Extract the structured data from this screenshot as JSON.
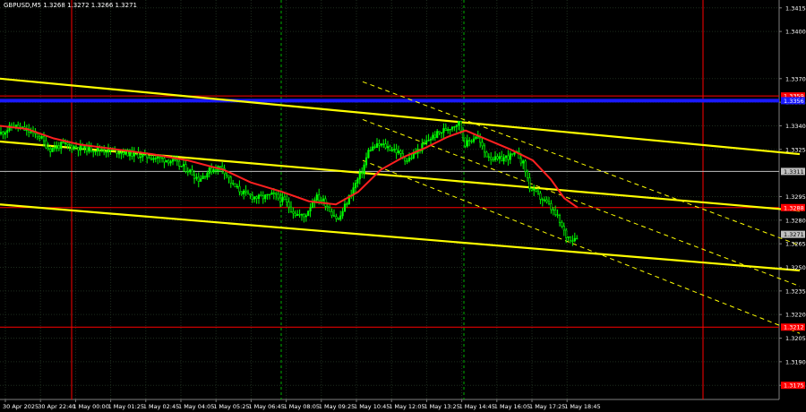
{
  "title": "GBPUSD,M5  1.3268 1.3272 1.3266 1.3271",
  "colors": {
    "background": "#000000",
    "grid": "#1e2d1e",
    "axis_text": "#ffffff",
    "candle": "#00ff00",
    "ma": "#ff2020",
    "trend": "#ffff00",
    "support_line": "#2020ff",
    "level_line": "#ff2020",
    "session_line": "#00b000",
    "label_red": "#ff0000",
    "label_blue": "#1a1aff",
    "label_grey": "#c0c0c0"
  },
  "chart_data": {
    "type": "candlestick",
    "symbol": "GBPUSD",
    "timeframe": "M5",
    "ohlc": {
      "open": 1.3268,
      "high": 1.3272,
      "low": 1.3266,
      "close": 1.3271
    },
    "y_range": [
      1.3166,
      1.342
    ],
    "y_ticks": [
      "1.3415",
      "1.3400",
      "1.3370",
      "1.3355",
      "1.3340",
      "1.3325",
      "1.3295",
      "1.3280",
      "1.3265",
      "1.3250",
      "1.3235",
      "1.3220",
      "1.3205",
      "1.3190",
      "1.3175"
    ],
    "x_ticks": [
      "30 Apr 2025",
      "30 Apr 22:40",
      "1 May 00:00",
      "1 May 01:25",
      "1 May 02:45",
      "1 May 04:05",
      "1 May 05:25",
      "1 May 06:45",
      "1 May 08:05",
      "1 May 09:25",
      "1 May 10:45",
      "1 May 12:05",
      "1 May 13:25",
      "1 May 14:45",
      "1 May 16:05",
      "1 May 17:25",
      "1 May 18:45"
    ],
    "price_labels": [
      {
        "text": "1.3359",
        "color": "#ff0000"
      },
      {
        "text": "1.3356",
        "color": "#1a1aff"
      },
      {
        "text": "1.3311",
        "color": "#c0c0c0"
      },
      {
        "text": "1.3288",
        "color": "#ff0000"
      },
      {
        "text": "1.3271",
        "color": "#c0c0c0"
      },
      {
        "text": "1.3212",
        "color": "#ff0000"
      },
      {
        "text": "1.3175",
        "color": "#ff0000"
      }
    ],
    "horizontal_levels": [
      {
        "price": 1.3356,
        "color": "#1a1aff",
        "style": "thick"
      },
      {
        "price": 1.3359,
        "color": "#ff0000",
        "style": "thin"
      },
      {
        "price": 1.3311,
        "color": "#c0c0c0",
        "style": "thin"
      },
      {
        "price": 1.3288,
        "color": "#ff0000",
        "style": "thin"
      },
      {
        "price": 1.3212,
        "color": "#ff0000",
        "style": "thin"
      }
    ],
    "trend_lines": [
      {
        "points": [
          [
            0,
            1.337
          ],
          [
            893,
            1.3322
          ]
        ],
        "style": "solid"
      },
      {
        "points": [
          [
            0,
            1.333
          ],
          [
            893,
            1.3286
          ]
        ],
        "style": "solid"
      },
      {
        "points": [
          [
            0,
            1.329
          ],
          [
            893,
            1.3248
          ]
        ],
        "style": "solid"
      },
      {
        "points": [
          [
            405,
            1.3368
          ],
          [
            893,
            1.3264
          ]
        ],
        "style": "dashed"
      },
      {
        "points": [
          [
            405,
            1.3344
          ],
          [
            893,
            1.3238
          ]
        ],
        "style": "dashed"
      },
      {
        "points": [
          [
            405,
            1.3318
          ],
          [
            893,
            1.3208
          ]
        ],
        "style": "dashed"
      }
    ],
    "vertical_lines": [
      {
        "x": 80,
        "color": "#ff0000",
        "style": "solid"
      },
      {
        "x": 785,
        "color": "#ff0000",
        "style": "solid"
      },
      {
        "x": 314,
        "color": "#00b000",
        "style": "dashed"
      },
      {
        "x": 518,
        "color": "#00b000",
        "style": "dashed"
      }
    ],
    "close_path": [
      [
        0,
        1.3335
      ],
      [
        15,
        1.334
      ],
      [
        30,
        1.3337
      ],
      [
        45,
        1.3333
      ],
      [
        55,
        1.3325
      ],
      [
        70,
        1.3328
      ],
      [
        90,
        1.3326
      ],
      [
        110,
        1.3325
      ],
      [
        130,
        1.3324
      ],
      [
        150,
        1.3322
      ],
      [
        170,
        1.332
      ],
      [
        190,
        1.3318
      ],
      [
        210,
        1.3312
      ],
      [
        222,
        1.3306
      ],
      [
        235,
        1.3312
      ],
      [
        248,
        1.3314
      ],
      [
        260,
        1.3302
      ],
      [
        275,
        1.3296
      ],
      [
        290,
        1.3294
      ],
      [
        305,
        1.3296
      ],
      [
        318,
        1.3292
      ],
      [
        330,
        1.3284
      ],
      [
        340,
        1.3282
      ],
      [
        352,
        1.3295
      ],
      [
        362,
        1.3292
      ],
      [
        370,
        1.3285
      ],
      [
        378,
        1.328
      ],
      [
        386,
        1.329
      ],
      [
        396,
        1.3302
      ],
      [
        405,
        1.3312
      ],
      [
        412,
        1.3325
      ],
      [
        425,
        1.3328
      ],
      [
        440,
        1.3325
      ],
      [
        455,
        1.3318
      ],
      [
        468,
        1.3325
      ],
      [
        480,
        1.3332
      ],
      [
        492,
        1.3336
      ],
      [
        505,
        1.334
      ],
      [
        512,
        1.3342
      ],
      [
        520,
        1.3328
      ],
      [
        532,
        1.3334
      ],
      [
        542,
        1.3322
      ],
      [
        555,
        1.3318
      ],
      [
        565,
        1.332
      ],
      [
        578,
        1.3322
      ],
      [
        585,
        1.3315
      ],
      [
        592,
        1.33
      ],
      [
        602,
        1.3295
      ],
      [
        612,
        1.329
      ],
      [
        622,
        1.3282
      ],
      [
        632,
        1.327
      ],
      [
        640,
        1.3268
      ],
      [
        646,
        1.3271
      ]
    ],
    "ma_path": [
      [
        0,
        1.334
      ],
      [
        30,
        1.3338
      ],
      [
        60,
        1.3332
      ],
      [
        90,
        1.3328
      ],
      [
        130,
        1.3325
      ],
      [
        170,
        1.3322
      ],
      [
        210,
        1.3318
      ],
      [
        250,
        1.3312
      ],
      [
        280,
        1.3304
      ],
      [
        315,
        1.3298
      ],
      [
        345,
        1.3292
      ],
      [
        375,
        1.329
      ],
      [
        400,
        1.3298
      ],
      [
        425,
        1.3312
      ],
      [
        450,
        1.332
      ],
      [
        475,
        1.3326
      ],
      [
        500,
        1.3333
      ],
      [
        520,
        1.3337
      ],
      [
        545,
        1.3331
      ],
      [
        570,
        1.3325
      ],
      [
        595,
        1.3318
      ],
      [
        615,
        1.3306
      ],
      [
        630,
        1.3294
      ],
      [
        645,
        1.3288
      ]
    ]
  }
}
